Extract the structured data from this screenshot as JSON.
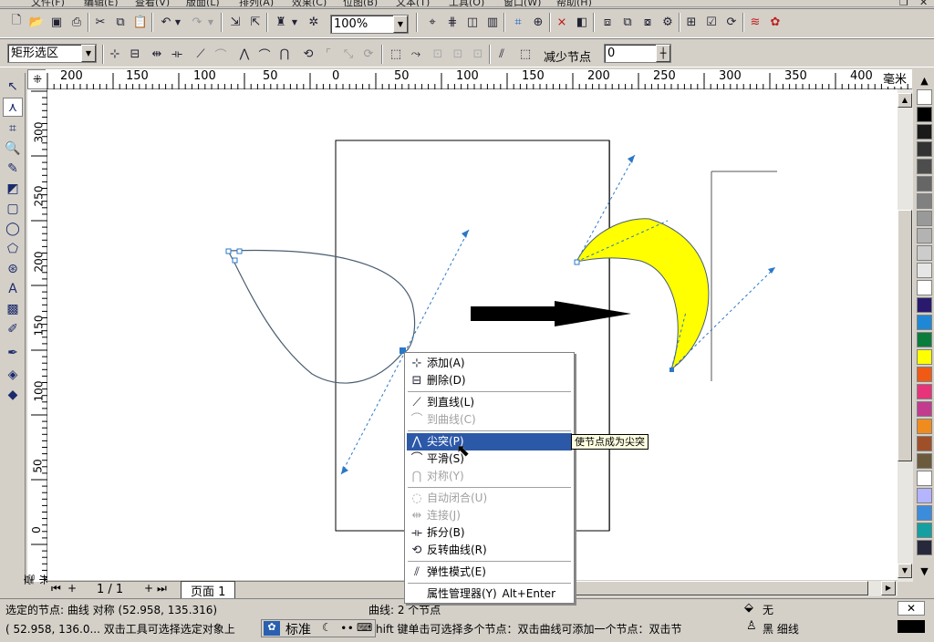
{
  "menubar": {
    "items": [
      "文件(F)",
      "编辑(E)",
      "查看(V)",
      "版面(L)",
      "排列(A)",
      "效果(C)",
      "位图(B)",
      "文本(T)",
      "工具(O)",
      "窗口(W)",
      "帮助(H)"
    ]
  },
  "toolbar1": {
    "zoom": "100%"
  },
  "toolbar2": {
    "selection_mode": "矩形选区",
    "reduce_nodes_label": "减少节点",
    "reduce_nodes_value": "0"
  },
  "ruler": {
    "unit": "毫米",
    "h_ticks": [
      "200",
      "150",
      "100",
      "50",
      "0",
      "50",
      "100",
      "150",
      "200",
      "250",
      "300",
      "350",
      "400"
    ],
    "v_ticks": [
      "300",
      "250",
      "200",
      "150",
      "100",
      "50",
      "0"
    ],
    "v_unit": "毫米"
  },
  "context_menu": {
    "items": [
      {
        "label": "添加(A)",
        "icon": "add-node-icon",
        "enabled": true
      },
      {
        "label": "删除(D)",
        "icon": "delete-node-icon",
        "enabled": true
      },
      {
        "label": "到直线(L)",
        "icon": "to-line-icon",
        "enabled": true
      },
      {
        "label": "到曲线(C)",
        "icon": "to-curve-icon",
        "enabled": false
      },
      {
        "label": "尖突(P)",
        "icon": "cusp-icon",
        "enabled": true,
        "selected": true
      },
      {
        "label": "平滑(S)",
        "icon": "smooth-icon",
        "enabled": true
      },
      {
        "label": "对称(Y)",
        "icon": "symmetric-icon",
        "enabled": false
      },
      {
        "label": "自动闭合(U)",
        "icon": "auto-close-icon",
        "enabled": false
      },
      {
        "label": "连接(J)",
        "icon": "join-icon",
        "enabled": false
      },
      {
        "label": "拆分(B)",
        "icon": "break-icon",
        "enabled": true
      },
      {
        "label": "反转曲线(R)",
        "icon": "reverse-curve-icon",
        "enabled": true
      },
      {
        "label": "弹性模式(E)",
        "icon": "elastic-mode-icon",
        "enabled": true
      },
      {
        "label": "属性管理器(Y)",
        "icon": "",
        "enabled": true,
        "shortcut": "Alt+Enter"
      }
    ]
  },
  "tooltip": "使节点成为尖突",
  "pages": {
    "counter": "1 / 1",
    "tab": "页面 1"
  },
  "status": {
    "line1_left": "选定的节点: 曲线 对称 (52.958, 135.316)",
    "line1_mid": "曲线: 2 个节点",
    "fill_label": "无",
    "line2_left": "( 52.958, 136.0...   双击工具可选择选定对象上",
    "ime_label": "标准",
    "line2_right": "hift 键单击可选择多个节点：双击曲线可添加一个节点：双击节",
    "outline_label": "黑  细线"
  },
  "palette": [
    "#ffffff",
    "#000000",
    "#1a1a1a",
    "#333333",
    "#4d4d4d",
    "#666666",
    "#808080",
    "#999999",
    "#b3b3b3",
    "#cccccc",
    "#e6e6e6",
    "#ffffff",
    "#2a1a6e",
    "#1e88d6",
    "#0a7c3c",
    "#ffff00",
    "#f05a14",
    "#e6337a",
    "#c23b8f",
    "#f08c1e",
    "#a05028",
    "#6b5a3c",
    "#ffffff",
    "#b4b4ff",
    "#3c8cdc",
    "#14a0a0",
    "#28283c"
  ],
  "colors": {
    "moon_fill": "#ffff00",
    "handle": "#2a78c8",
    "selection": "#2c58a8"
  }
}
